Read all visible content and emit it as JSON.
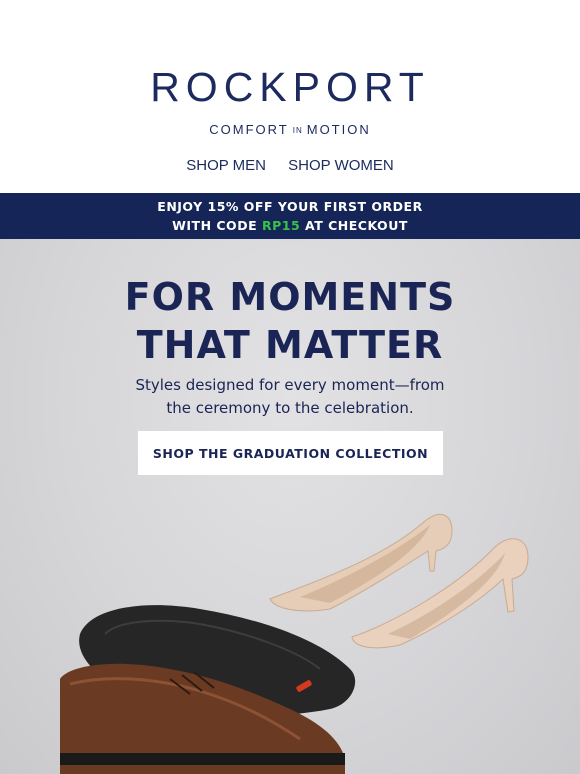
{
  "header": {
    "logo": "ROCKPORT",
    "tagline_left": "COMFORT",
    "tagline_mid": "IN",
    "tagline_right": "MOTION",
    "nav": [
      "SHOP MEN",
      "SHOP WOMEN"
    ]
  },
  "promo": {
    "line1": "ENJOY 15% OFF YOUR FIRST ORDER",
    "line2_prefix": "WITH CODE ",
    "code": "RP15",
    "line2_suffix": " AT CHECKOUT"
  },
  "hero": {
    "headline_line1": "FOR MOMENTS",
    "headline_line2": "THAT MATTER",
    "sub_line1": "Styles designed for every moment—from",
    "sub_line2": "the ceremony to the celebration.",
    "cta": "SHOP THE GRADUATION COLLECTION"
  },
  "colors": {
    "brand_navy": "#1c2a5e",
    "promo_bg": "#152557",
    "code_green": "#36c24a",
    "hero_bg": "#d6d5d8"
  },
  "images": {
    "heels": "nude-pointed-pumps-image",
    "oxfords": "brown-cap-toe-oxfords-image"
  }
}
